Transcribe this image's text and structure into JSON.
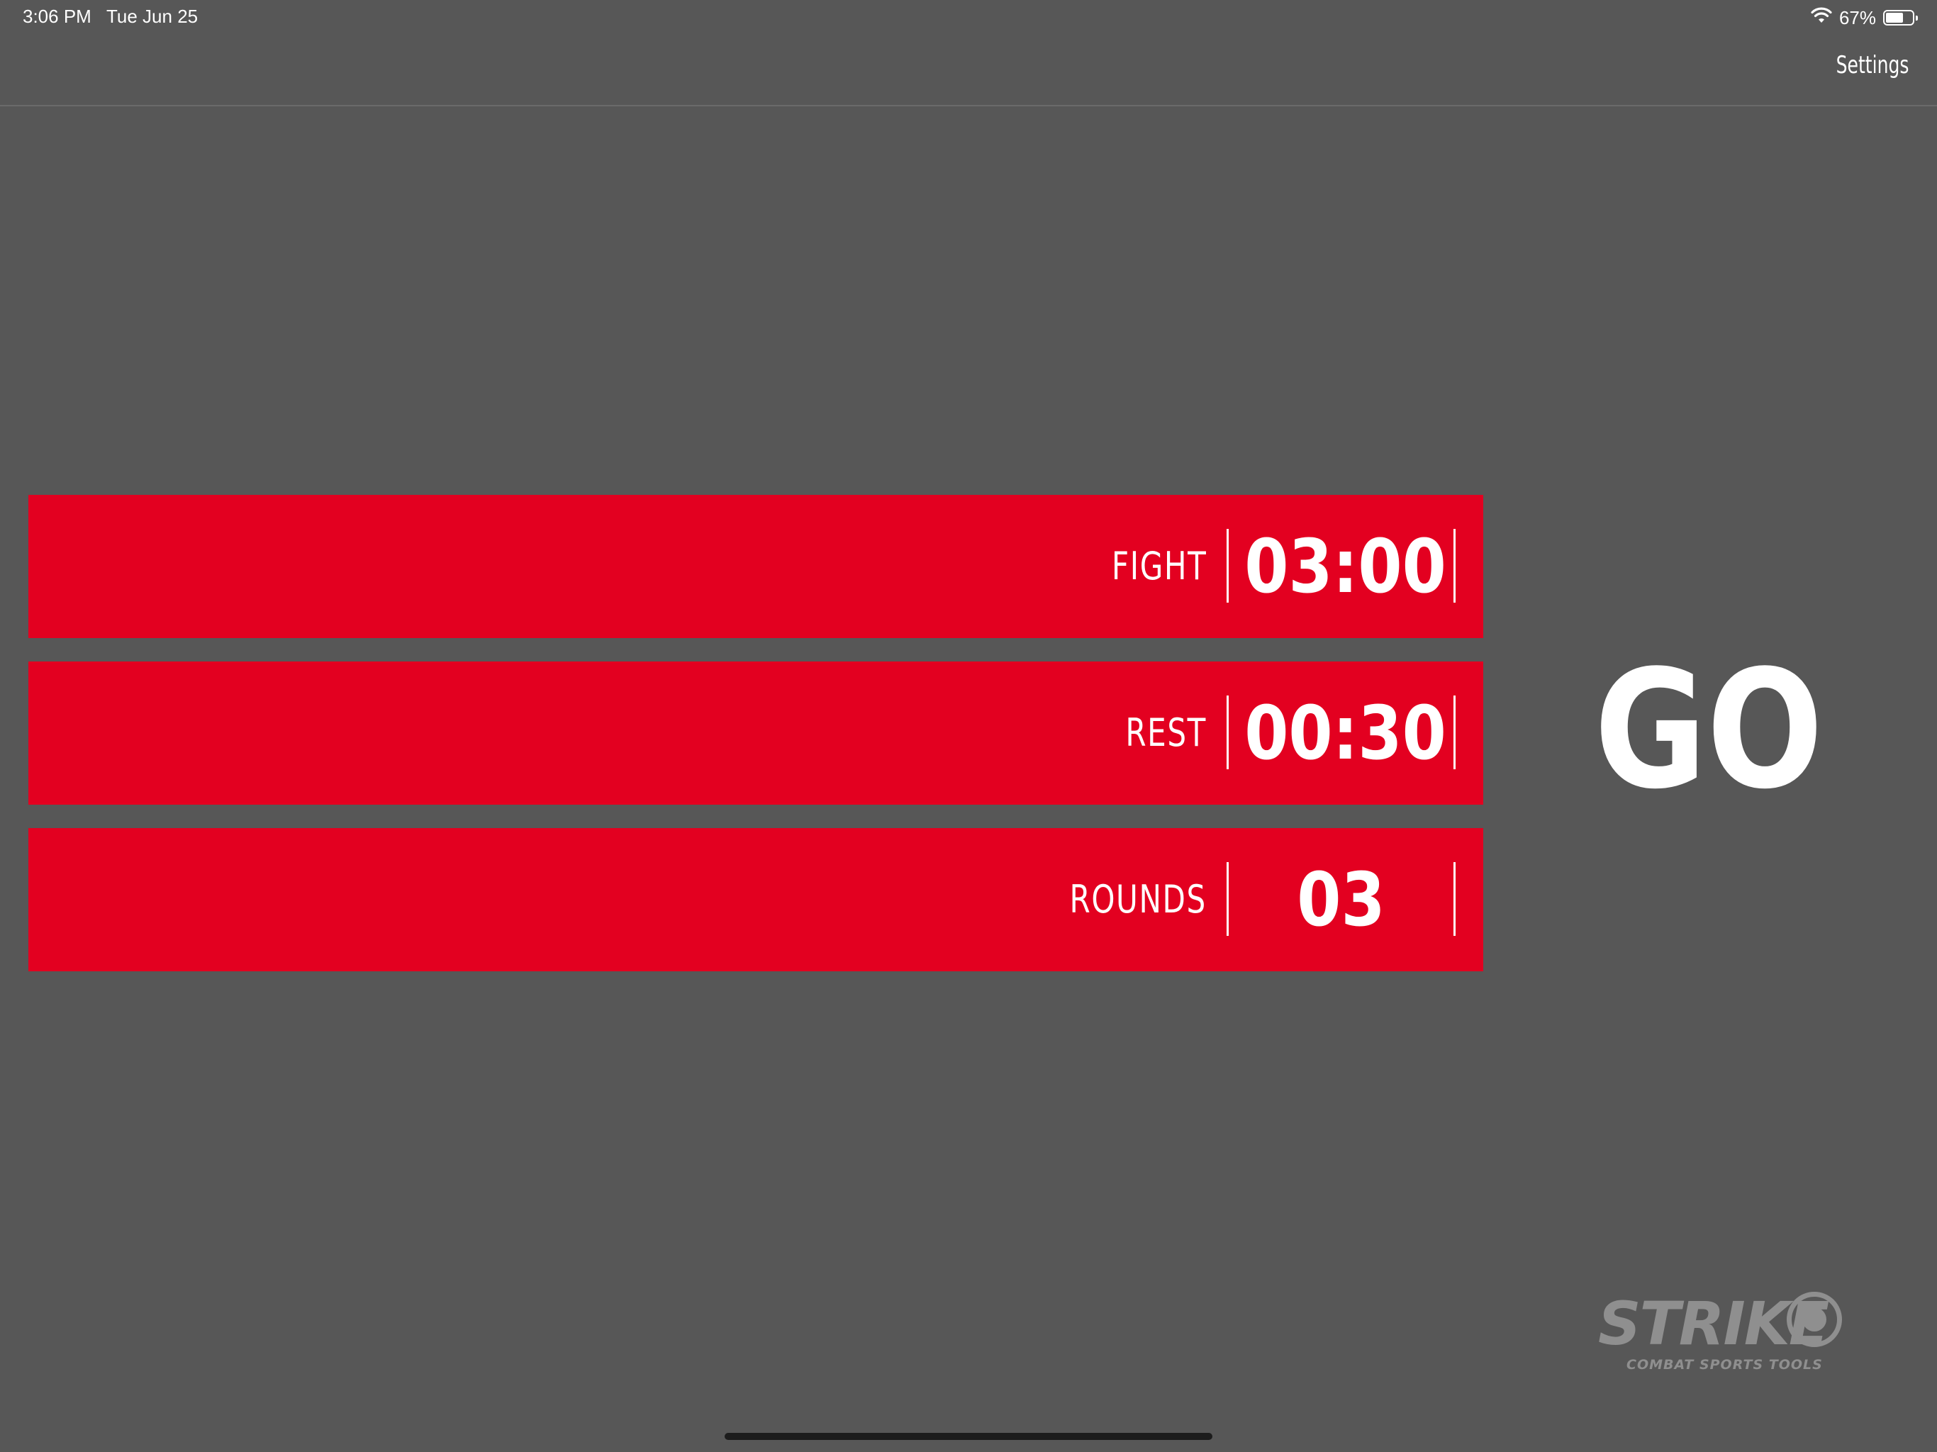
{
  "status_bar": {
    "time": "3:06 PM",
    "date": "Tue Jun 25",
    "battery_percent_label": "67%",
    "battery_level": 0.67
  },
  "nav": {
    "settings_label": "Settings"
  },
  "panels": [
    {
      "label": "FIGHT",
      "value": "03:00"
    },
    {
      "label": "REST",
      "value": "00:30"
    },
    {
      "label": "ROUNDS",
      "value": "03"
    }
  ],
  "go_label": "GO",
  "logo": {
    "name": "STRIKE",
    "tagline": "COMBAT SPORTS TOOLS"
  },
  "colors": {
    "background": "#575757",
    "panel": "#e30020",
    "text": "#ffffff"
  },
  "icons": {
    "wifi": "wifi-icon",
    "battery": "battery-icon",
    "logo_mark": "target-icon"
  }
}
